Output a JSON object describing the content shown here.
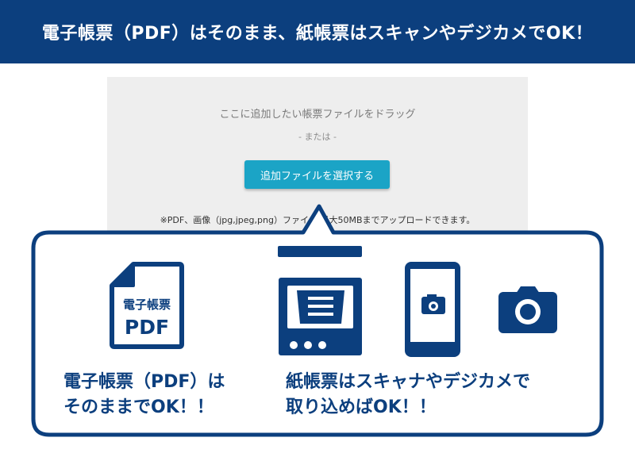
{
  "banner": {
    "title": "電子帳票（PDF）はそのまま、紙帳票はスキャンやデジカメでOK！"
  },
  "upload": {
    "prompt": "ここに追加したい帳票ファイルをドラッグ",
    "or_text": "- または -",
    "select_button": "追加ファイルを選択する",
    "note": "※PDF、画像（jpg,jpeg,png）ファイル 最大50MBまでアップロードできます。"
  },
  "callout": {
    "pdf_icon": {
      "icon": "pdf-document-icon",
      "line1": "電子帳票",
      "line2": "PDF"
    },
    "scanner_icon": "scanner-icon",
    "smartphone_icon": "smartphone-camera-icon",
    "camera_icon": "camera-icon",
    "left_caption": {
      "line1": "電子帳票（PDF）は",
      "line2": "そのままでOK！！"
    },
    "right_caption": {
      "line1": "紙帳票はスキャナやデジカメで",
      "line2": "取り込めばOK！！"
    }
  },
  "colors": {
    "brand_navy": "#0c3f7e",
    "button_teal": "#1ba4c6",
    "panel_gray": "#eeeeee"
  }
}
